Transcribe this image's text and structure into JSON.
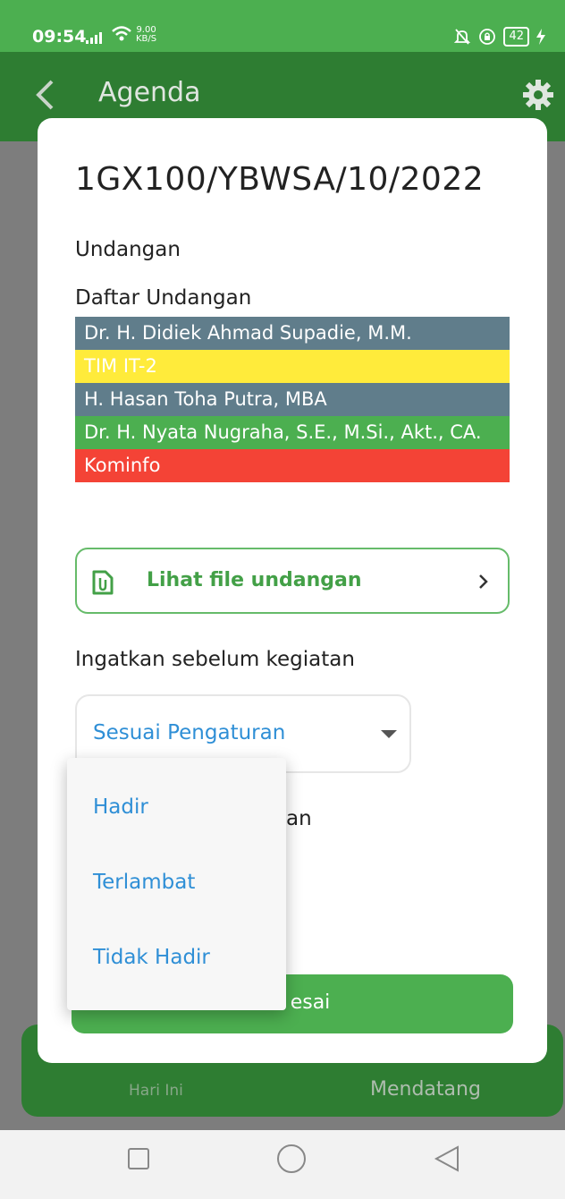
{
  "status_bar": {
    "time": "09:54",
    "speed_value": "9.00",
    "speed_unit": "KB/S",
    "battery": "42"
  },
  "app_bar": {
    "title": "Agenda"
  },
  "bottom_nav": {
    "today_label": "Hari Ini",
    "upcoming_label": "Mendatang"
  },
  "modal": {
    "title": "1GX100/YBWSA/10/2022",
    "type_label": "Undangan",
    "invitee_list_label": "Daftar Undangan",
    "invitees": [
      {
        "name": "Dr. H. Didiek Ahmad Supadie, M.M.",
        "color": "#607d8b"
      },
      {
        "name": "TIM IT-2",
        "color": "#ffeb3b"
      },
      {
        "name": "H. Hasan Toha Putra, MBA",
        "color": "#607d8b"
      },
      {
        "name": "Dr. H. Nyata Nugraha, S.E., M.Si., Akt., CA.",
        "color": "#4caf50"
      },
      {
        "name": "Kominfo",
        "color": "#f44336"
      }
    ],
    "file_button_label": "Lihat file undangan",
    "reminder_label": "Ingatkan sebelum kegiatan",
    "reminder_value": "Sesuai Pengaturan",
    "status_label_visible": "an",
    "done_button_label": "esai"
  },
  "dropdown": {
    "options": [
      "Hadir",
      "Terlambat",
      "Tidak Hadir"
    ]
  },
  "colors": {
    "primary_green": "#4caf50",
    "dark_green": "#2e7d32",
    "link_blue": "#2f8fd6"
  },
  "icons": [
    "back-arrow-icon",
    "gear-icon",
    "file-attachment-icon",
    "chevron-right-icon",
    "caret-down-icon",
    "square-nav-icon",
    "circle-nav-icon",
    "triangle-back-nav-icon"
  ]
}
